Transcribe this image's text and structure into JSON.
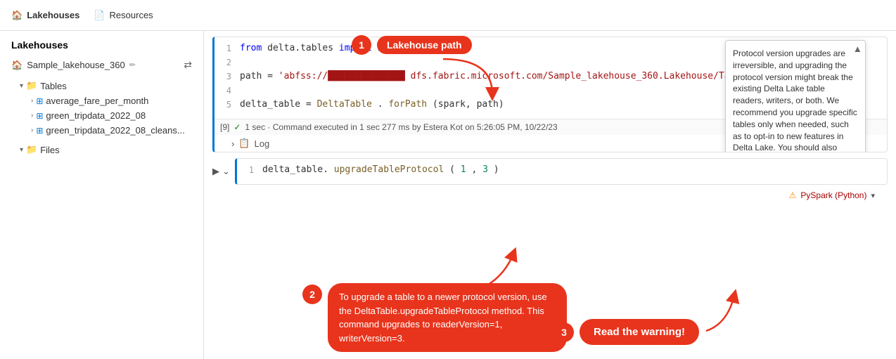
{
  "header": {
    "lakehouses_label": "Lakehouses",
    "resources_label": "Resources"
  },
  "sidebar": {
    "title": "Lakehouses",
    "lakehouse_name": "Sample_lakehouse_360",
    "sections": {
      "tables_label": "Tables",
      "tables_expanded": true,
      "table_items": [
        "average_fare_per_month",
        "green_tripdata_2022_08",
        "green_tripdata_2022_08_cleans..."
      ],
      "files_label": "Files",
      "files_expanded": true
    }
  },
  "code_cell_1": {
    "lines": [
      {
        "num": "1",
        "code": "from delta.tables import DeltaTable"
      },
      {
        "num": "2",
        "code": ""
      },
      {
        "num": "3",
        "code": "path = 'abfss://███████████████ dfs.fabric.microsoft.com/Sample_lakehouse_360.Lakehouse/Tables/average_f"
      },
      {
        "num": "4",
        "code": ""
      },
      {
        "num": "5",
        "code": "delta_table = DeltaTable.forPath(spark, path)"
      }
    ],
    "output": "[9]",
    "output_status": "1 sec · Command executed in 1 sec 277 ms by Estera Kot on 5:26:05 PM, 10/22/23",
    "log_label": "Log"
  },
  "tooltip": {
    "text": "Protocol version upgrades are irreversible, and upgrading the protocol version might break the existing Delta Lake table readers, writers, or both. We recommend you upgrade specific tables only when needed, such as to opt-in to new features in Delta Lake. You should also check to make sure that all of your current and future production tools support Delta Lake tables with the new protocol version."
  },
  "code_cell_2": {
    "lines": [
      {
        "num": "1",
        "code": "delta_table.upgradeTableProtocol(1,3)"
      }
    ]
  },
  "warning": {
    "label": "PySpark (Python)",
    "icon": "⚠"
  },
  "annotations": {
    "bubble1": {
      "number": "1",
      "label": "Lakehouse path"
    },
    "bubble2": {
      "number": "2",
      "text": "To upgrade a table to a newer protocol version, use the DeltaTable.upgradeTableProtocol method. This command upgrades to readerVersion=1, writerVersion=3."
    },
    "bubble3": {
      "number": "3",
      "text": "Read the warning!"
    }
  }
}
